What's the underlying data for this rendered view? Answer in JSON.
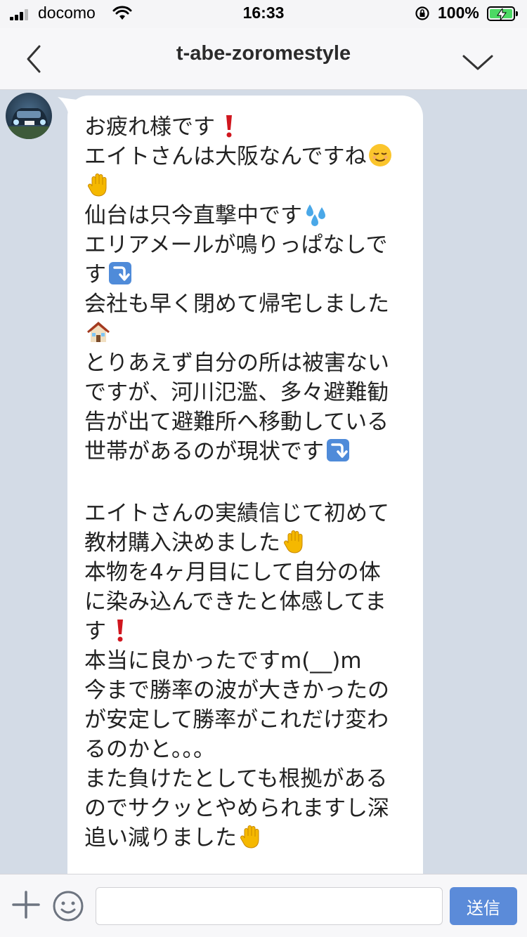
{
  "status_bar": {
    "carrier": "docomo",
    "time": "16:33",
    "battery": "100%"
  },
  "header": {
    "title": "t-abe-zoromestyle",
    "back_icon": "chevron-left-icon",
    "menu_icon": "chevron-down-icon"
  },
  "message": {
    "lines": [
      {
        "text": "お疲れ様です",
        "emoji": "exclamation-icon"
      },
      {
        "text": "エイトさんは大阪なんですね",
        "emoji": "relieved-face-icon"
      },
      {
        "text": "",
        "emoji": "raised-hand-icon"
      },
      {
        "text": "仙台は只今直撃中です",
        "emoji": "sweat-drops-icon"
      },
      {
        "text": "エリアメールが鳴りっぱなしで",
        "emoji": ""
      },
      {
        "text": "す",
        "emoji": "arrow-down-right-icon"
      },
      {
        "text": "会社も早く閉めて帰宅しました",
        "emoji": ""
      },
      {
        "text": "",
        "emoji": "house-icon"
      },
      {
        "text": "とりあえず自分の所は被害ない",
        "emoji": ""
      },
      {
        "text": "ですが、河川氾濫、多々避難勧",
        "emoji": ""
      },
      {
        "text": "告が出て避難所へ移動している",
        "emoji": ""
      },
      {
        "text": "世帯があるのが現状です",
        "emoji": "arrow-down-right-icon"
      },
      {
        "text": "",
        "emoji": "",
        "gap": true
      },
      {
        "text": "エイトさんの実績信じて初めて",
        "emoji": ""
      },
      {
        "text": "教材購入決めました",
        "emoji": "raised-hand-icon"
      },
      {
        "text": "本物を4ヶ月目にして自分の体",
        "emoji": ""
      },
      {
        "text": "に染み込んできたと体感してま",
        "emoji": ""
      },
      {
        "text": "す",
        "emoji": "exclamation-icon"
      },
      {
        "text": "本当に良かったですm(__)m",
        "emoji": ""
      },
      {
        "text": "今まで勝率の波が大きかったの",
        "emoji": ""
      },
      {
        "text": "が安定して勝率がこれだけ変わ",
        "emoji": ""
      },
      {
        "text": "るのかと。。。",
        "emoji": ""
      },
      {
        "text": "また負けたとしても根拠がある",
        "emoji": ""
      },
      {
        "text": "のでサクッとやめられますし深",
        "emoji": ""
      },
      {
        "text": "追い減りました",
        "emoji": "raised-hand-icon"
      }
    ]
  },
  "input_bar": {
    "placeholder": "",
    "send_label": "送信"
  }
}
